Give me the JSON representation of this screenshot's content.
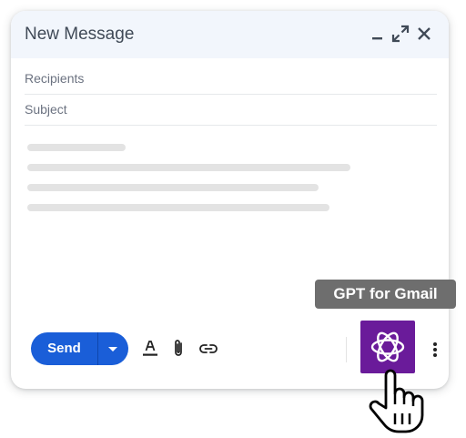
{
  "compose": {
    "title": "New Message",
    "recipients_placeholder": "Recipients",
    "subject_placeholder": "Subject"
  },
  "toolbar": {
    "send_label": "Send"
  },
  "tooltip": {
    "text": "GPT for Gmail"
  },
  "icons": [
    "minimize-icon",
    "expand-icon",
    "close-icon",
    "send-options-chevron-icon",
    "text-format-icon",
    "attach-icon",
    "link-icon",
    "openai-logo-icon",
    "more-vert-icon",
    "hand-pointer-cursor-icon"
  ],
  "colors": {
    "send_button": "#1a5ed8",
    "gpt_button": "#6a1b9a",
    "tooltip_bg": "#6e6e6e",
    "header_bg": "#f2f6fc"
  }
}
